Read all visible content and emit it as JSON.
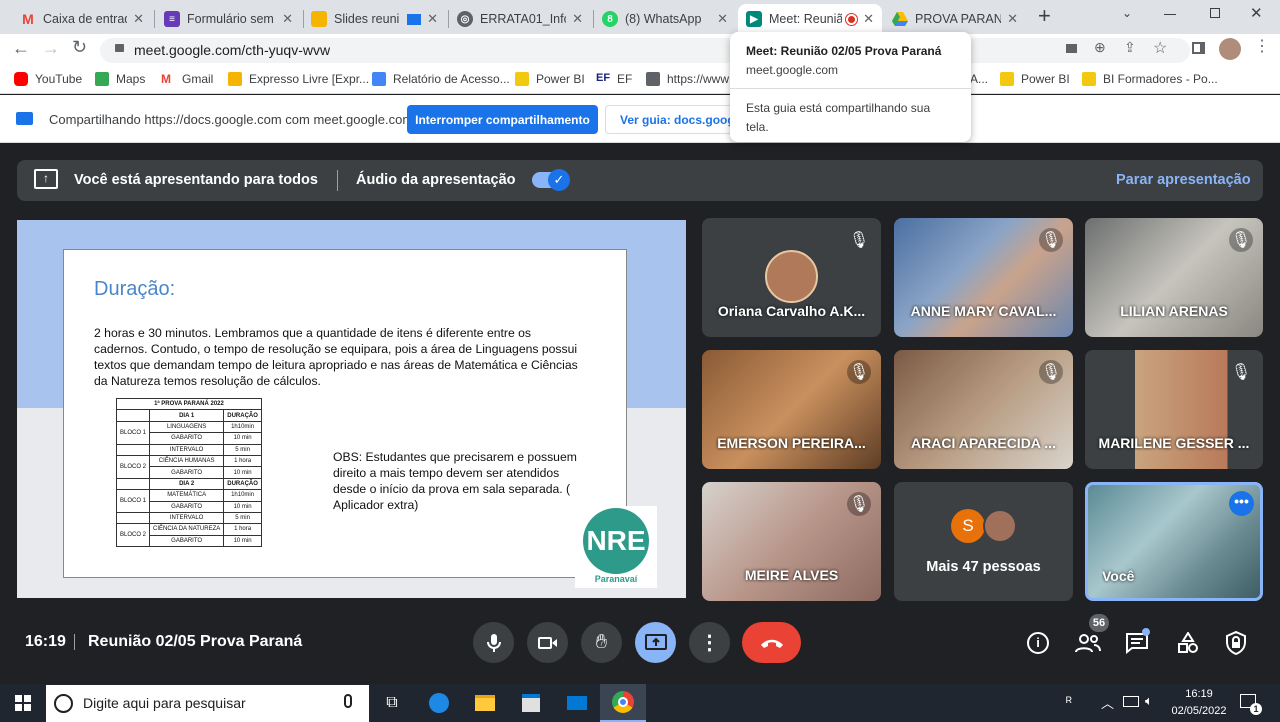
{
  "browser": {
    "tabs": [
      {
        "title": "Caixa de entrada",
        "icon": "gmail-icon",
        "color": "#ea4335"
      },
      {
        "title": "Formulário sem t",
        "icon": "forms-icon",
        "color": "#673ab7"
      },
      {
        "title": "Slides reuni",
        "icon": "slides-icon",
        "color": "#f4b400"
      },
      {
        "title": "ERRATA01_Inform",
        "icon": "globe-icon",
        "color": "#5f6368"
      },
      {
        "title": "(8) WhatsApp",
        "icon": "whatsapp-icon",
        "color": "#25d366"
      },
      {
        "title": "Meet: Reuniã",
        "icon": "meet-icon",
        "color": "#00897b",
        "active": true
      },
      {
        "title": "PROVA PARANÁ",
        "icon": "drive-icon",
        "color": "#1fa463"
      }
    ],
    "url": "meet.google.com/cth-yuqv-wvw",
    "bookmarks": [
      {
        "label": "YouTube",
        "color": "#ff0000"
      },
      {
        "label": "Maps",
        "color": "#34a853"
      },
      {
        "label": "Gmail",
        "color": "#ea4335"
      },
      {
        "label": "Expresso Livre [Expr...",
        "color": "#f4b400"
      },
      {
        "label": "Relatório de Acesso...",
        "color": "#4285f4"
      },
      {
        "label": "Power BI",
        "color": "#f2c811"
      },
      {
        "label": "EF",
        "color": "#1a237e"
      },
      {
        "label": "https://www",
        "color": "#5f6368"
      },
      {
        "label": "A...",
        "color": "#5f6368"
      },
      {
        "label": "Power BI",
        "color": "#f2c811"
      },
      {
        "label": "BI Formadores - Po...",
        "color": "#f2c811"
      }
    ],
    "tooltip": {
      "title": "Meet: Reunião 02/05 Prova Paraná",
      "domain": "meet.google.com",
      "message": "Esta guia está compartilhando sua tela."
    }
  },
  "sharebar": {
    "text": "Compartilhando https://docs.google.com com meet.google.com",
    "stop_button": "Interromper compartilhamento",
    "view_button": "Ver guia: docs.google"
  },
  "meet": {
    "presenting_text": "Você está apresentando para todos",
    "audio_label": "Áudio da apresentação",
    "audio_enabled": true,
    "stop_presenting": "Parar apresentação",
    "meeting_time": "16:19",
    "meeting_title": "Reunião 02/05 Prova Paraná",
    "participants_count": "56",
    "participants": [
      {
        "name": "Oriana Carvalho A.K...",
        "muted": true
      },
      {
        "name": "ANNE MARY CAVAL...",
        "muted": true
      },
      {
        "name": "LILIAN ARENAS",
        "muted": true
      },
      {
        "name": "EMERSON PEREIRA...",
        "muted": true
      },
      {
        "name": "ARACI APARECIDA ...",
        "muted": true
      },
      {
        "name": "MARILENE GESSER ...",
        "muted": true
      },
      {
        "name": "MEIRE ALVES",
        "muted": true
      },
      {
        "name": "Mais 47 pessoas",
        "initial": "S"
      },
      {
        "name": "Você"
      }
    ]
  },
  "slide": {
    "title": "Duração:",
    "body": "2 horas e 30 minutos. Lembramos que a quantidade de itens é diferente entre os cadernos. Contudo, o tempo de resolução se equipara, pois a área de Linguagens possui textos que demandam tempo de leitura apropriado e nas áreas de Matemática e Ciências da Natureza temos resolução de cálculos.",
    "obs": "OBS: Estudantes que precisarem e possuem direito  a mais tempo devem ser atendidos desde o início da prova em sala separada. ( Aplicador extra)",
    "logo_text": "NRE",
    "logo_caption": "Paranavaí",
    "table": {
      "title": "1ª PROVA PARANÁ 2022",
      "day1": "DIA 1",
      "day2": "DIA 2",
      "duration_header": "DURAÇÃO",
      "bloco1": "BLOCO 1",
      "bloco2": "BLOCO 2",
      "rows_day1": [
        [
          "LINGUAGENS",
          "1h10min"
        ],
        [
          "GABARITO",
          "10 min"
        ],
        [
          "INTERVALO",
          "5 min"
        ],
        [
          "CIÊNCIA HUMANAS",
          "1 hora"
        ],
        [
          "GABARITO",
          "10 min"
        ]
      ],
      "rows_day2": [
        [
          "MATEMÁTICA",
          "1h10min"
        ],
        [
          "GABARITO",
          "10 min"
        ],
        [
          "INTERVALO",
          "5 min"
        ],
        [
          "CIÊNCIA DA NATUREZA",
          "1 hora"
        ],
        [
          "GABARITO",
          "10 min"
        ]
      ]
    }
  },
  "taskbar": {
    "search_placeholder": "Digite aqui para pesquisar",
    "time": "16:19",
    "date": "02/05/2022",
    "notification_count": "1"
  }
}
